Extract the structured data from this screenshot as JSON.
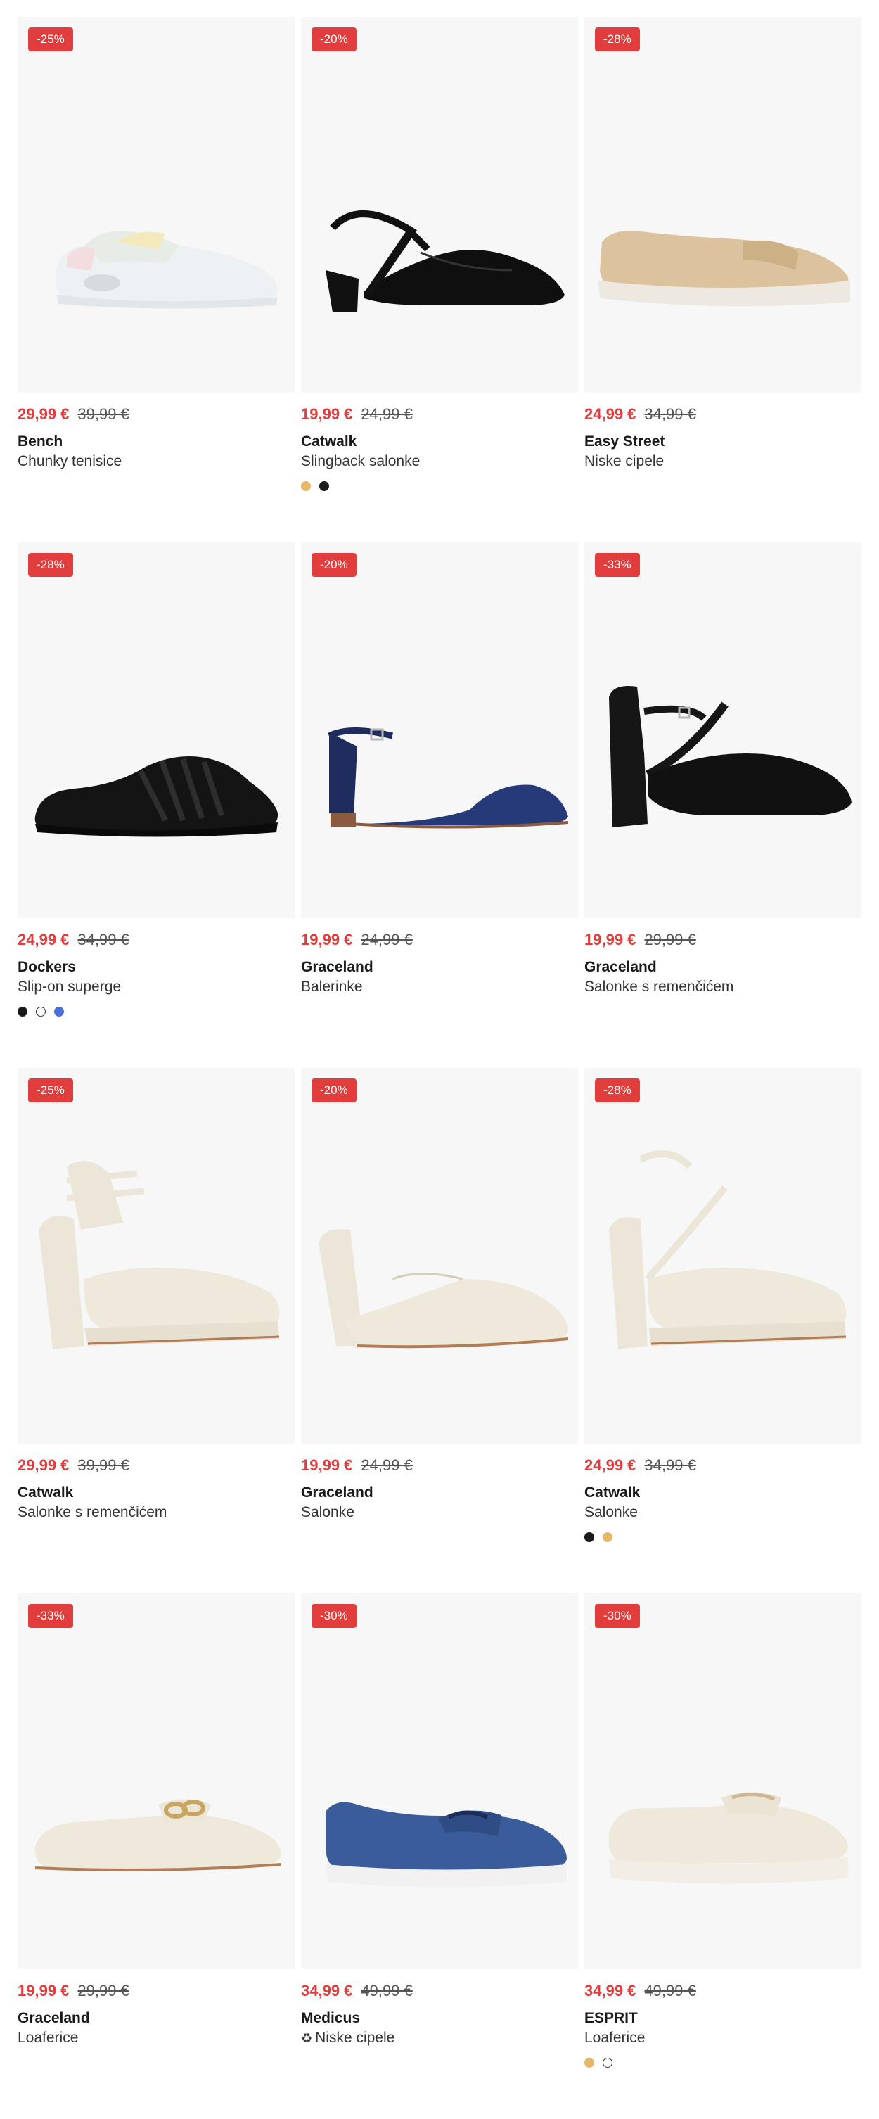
{
  "products": [
    {
      "discount": "-25%",
      "price": "29,99 €",
      "old_price": "39,99 €",
      "brand": "Bench",
      "name": "Chunky tenisice",
      "swatches": [],
      "shoe": "sneaker-white"
    },
    {
      "discount": "-20%",
      "price": "19,99 €",
      "old_price": "24,99 €",
      "brand": "Catwalk",
      "name": "Slingback salonke",
      "swatches": [
        "#e6b96a",
        "#1a1a1a"
      ],
      "shoe": "slingback-black"
    },
    {
      "discount": "-28%",
      "price": "24,99 €",
      "old_price": "34,99 €",
      "brand": "Easy Street",
      "name": "Niske cipele",
      "swatches": [],
      "shoe": "loafer-beige"
    },
    {
      "discount": "-28%",
      "price": "24,99 €",
      "old_price": "34,99 €",
      "brand": "Dockers",
      "name": "Slip-on superge",
      "swatches": [
        "#1a1a1a",
        "#ffffff",
        "#4a6fd8"
      ],
      "shoe": "sneaker-black"
    },
    {
      "discount": "-20%",
      "price": "19,99 €",
      "old_price": "24,99 €",
      "brand": "Graceland",
      "name": "Balerinke",
      "swatches": [],
      "shoe": "ballerina-navy"
    },
    {
      "discount": "-33%",
      "price": "19,99 €",
      "old_price": "29,99 €",
      "brand": "Graceland",
      "name": "Salonke s remenčićem",
      "swatches": [],
      "shoe": "pump-strap-black"
    },
    {
      "discount": "-25%",
      "price": "29,99 €",
      "old_price": "39,99 €",
      "brand": "Catwalk",
      "name": "Salonke s remenčićem",
      "swatches": [],
      "shoe": "platform-cream-strap"
    },
    {
      "discount": "-20%",
      "price": "19,99 €",
      "old_price": "24,99 €",
      "brand": "Graceland",
      "name": "Salonke",
      "swatches": [],
      "shoe": "pump-cream"
    },
    {
      "discount": "-28%",
      "price": "24,99 €",
      "old_price": "34,99 €",
      "brand": "Catwalk",
      "name": "Salonke",
      "swatches": [
        "#1a1a1a",
        "#e6b96a"
      ],
      "shoe": "platform-cream-cross"
    },
    {
      "discount": "-33%",
      "price": "19,99 €",
      "old_price": "29,99 €",
      "brand": "Graceland",
      "name": "Loaferice",
      "swatches": [],
      "shoe": "loafer-cream-chain"
    },
    {
      "discount": "-30%",
      "price": "34,99 €",
      "old_price": "49,99 €",
      "brand": "Medicus",
      "name": "Niske cipele",
      "eco_icon": "♻",
      "swatches": [],
      "shoe": "slipon-blue"
    },
    {
      "discount": "-30%",
      "price": "34,99 €",
      "old_price": "49,99 €",
      "brand": "ESPRIT",
      "name": "Loaferice",
      "swatches": [
        "#e6b96a",
        "#ffffff"
      ],
      "shoe": "loafer-chunky-cream"
    }
  ]
}
